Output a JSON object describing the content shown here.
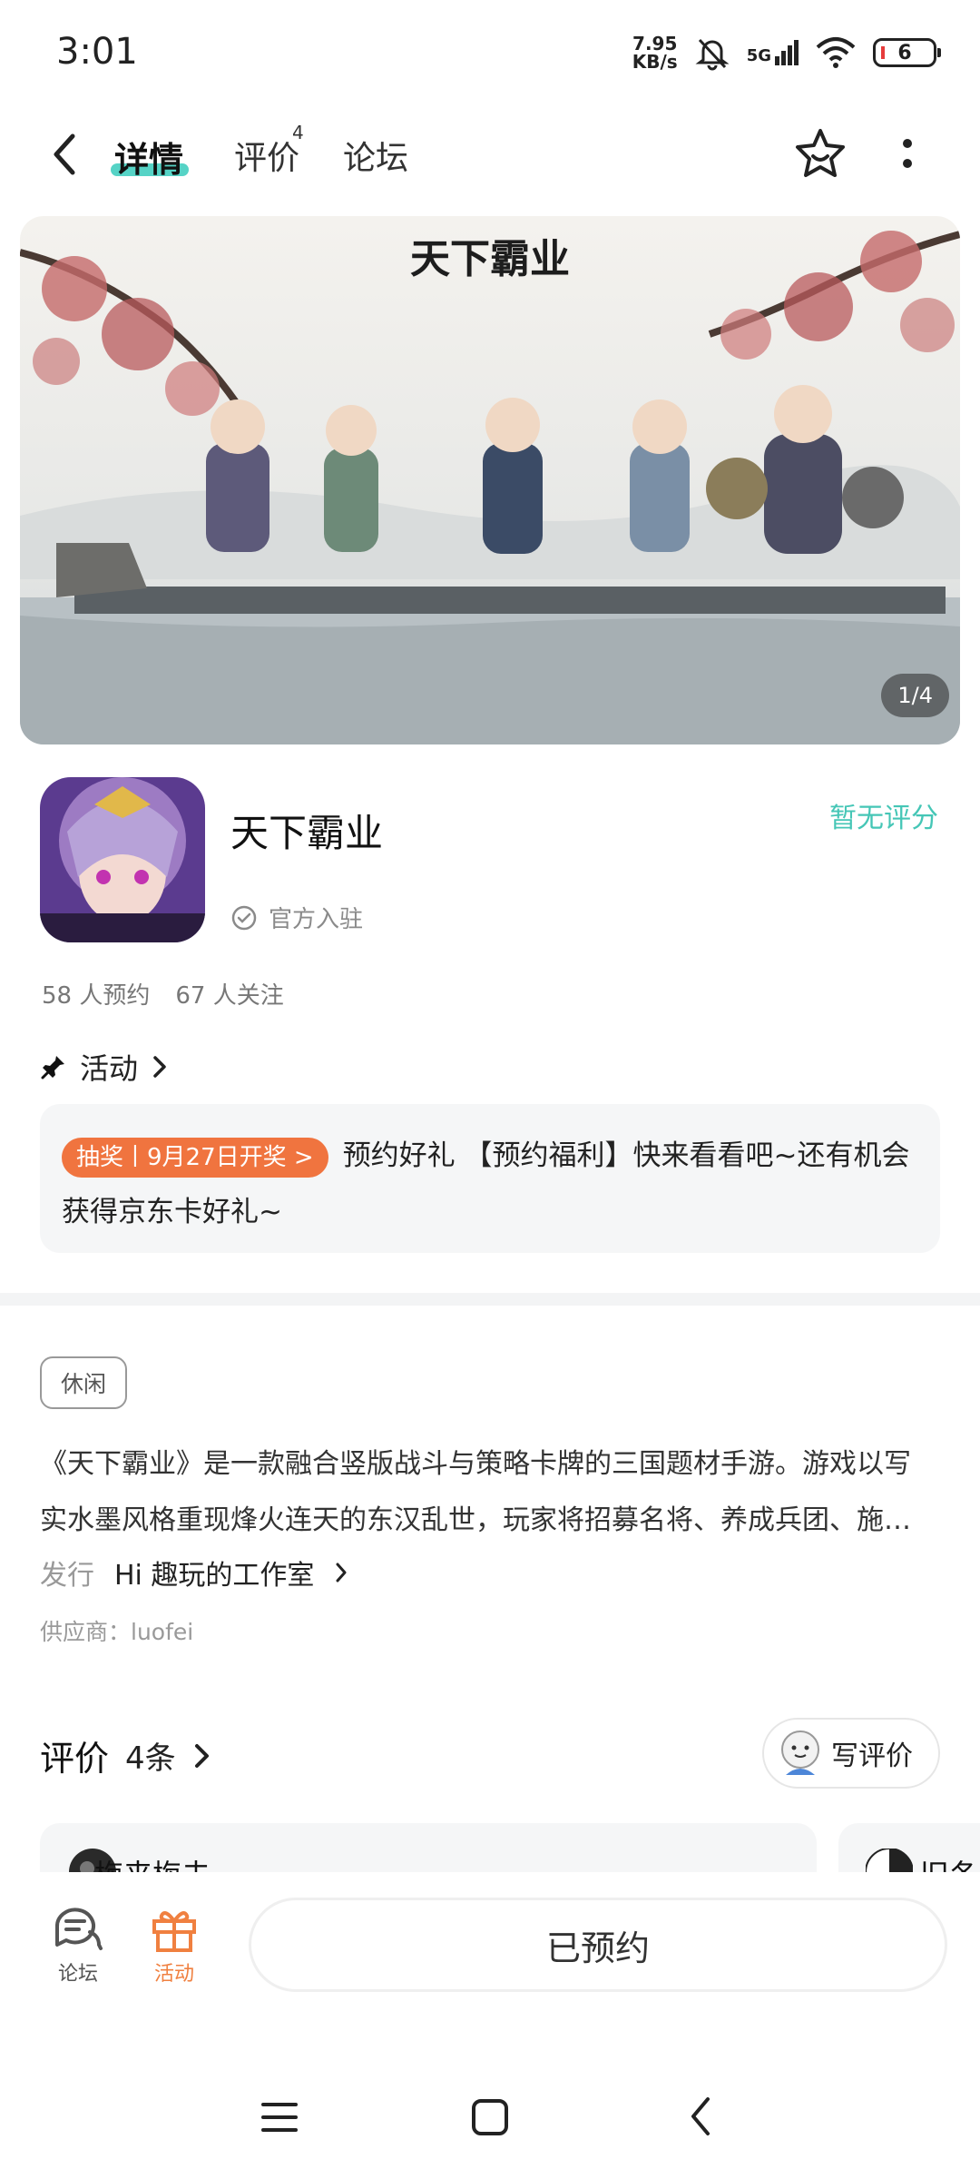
{
  "status_bar": {
    "time": "3:01",
    "net_speed_value": "7.95",
    "net_speed_unit": "KB/s",
    "network": "5G",
    "battery": "6"
  },
  "nav": {
    "tabs": [
      {
        "label": "详情",
        "active": true
      },
      {
        "label": "评价",
        "badge": "4"
      },
      {
        "label": "论坛"
      }
    ],
    "accent_color": "#56d3c6"
  },
  "banner": {
    "title_art": "天下霸业",
    "counter": "1/4"
  },
  "app": {
    "name": "天下霸业",
    "rating_text": "暂无评分",
    "official_text": "官方入驻",
    "reservations": "58 人预约",
    "followers": "67 人关注"
  },
  "activity": {
    "title": "活动",
    "tag": "抽奖丨9月27日开奖 >",
    "text": "预约好礼 【预约福利】快来看看吧~还有机会获得京东卡好礼~"
  },
  "details": {
    "tag": "休闲",
    "description_line1": "《天下霸业》是一款融合竖版战斗与策略卡牌的三国题材手游。游戏以写",
    "description_line2": "实水墨风格重现烽火连天的东汉乱世，玩家将招募名将、养成兵团、施…",
    "publisher_label": "发行",
    "publisher_value": "Hi 趣玩的工作室",
    "supplier": "供应商：luofei"
  },
  "reviews": {
    "title": "评价",
    "count": "4条",
    "write_label": "写评价",
    "cards": [
      {
        "user": "梅来梅去"
      },
      {
        "user": "旧冬"
      }
    ]
  },
  "bottom_bar": {
    "forum_label": "论坛",
    "activity_label": "活动",
    "reserved_label": "已预约",
    "activity_color": "#f08040"
  }
}
